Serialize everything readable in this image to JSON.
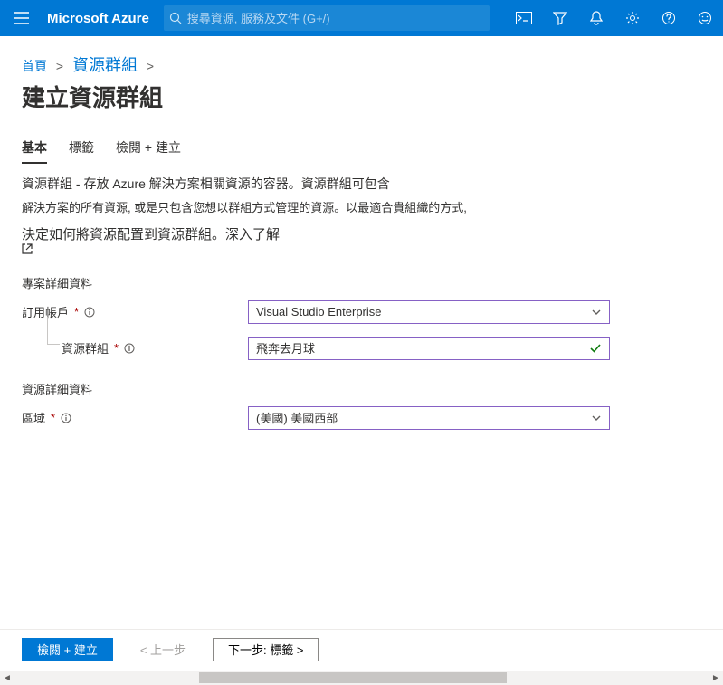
{
  "header": {
    "brand": "Microsoft Azure",
    "search_placeholder": "搜尋資源, 服務及文件 (G+/)"
  },
  "breadcrumb": {
    "home": "首頁",
    "current": "資源群組"
  },
  "page": {
    "title": "建立資源群組"
  },
  "tabs": [
    {
      "label": "基本",
      "active": true
    },
    {
      "label": "標籤",
      "active": false
    },
    {
      "label": "檢閱 + 建立",
      "active": false
    }
  ],
  "description": {
    "line1": "資源群組 - 存放 Azure 解決方案相關資源的容器。資源群組可包含",
    "line2": "解決方案的所有資源, 或是只包含您想以群組方式管理的資源。以最適合貴組織的方式,",
    "line3_prefix": "決定如何將資源配置到資源群組。",
    "learn_more": "深入了解"
  },
  "sections": {
    "project_details": "專案詳細資料",
    "resource_details": "資源詳細資料"
  },
  "fields": {
    "subscription": {
      "label": "訂用帳戶",
      "value": "Visual Studio Enterprise"
    },
    "resource_group": {
      "label": "資源群組",
      "value": "飛奔去月球"
    },
    "region": {
      "label": "區域",
      "value": "(美國) 美國西部"
    }
  },
  "footer": {
    "review": "檢閱 + 建立",
    "prev": "< 上一步",
    "next": "下一步: 標籤 >"
  }
}
